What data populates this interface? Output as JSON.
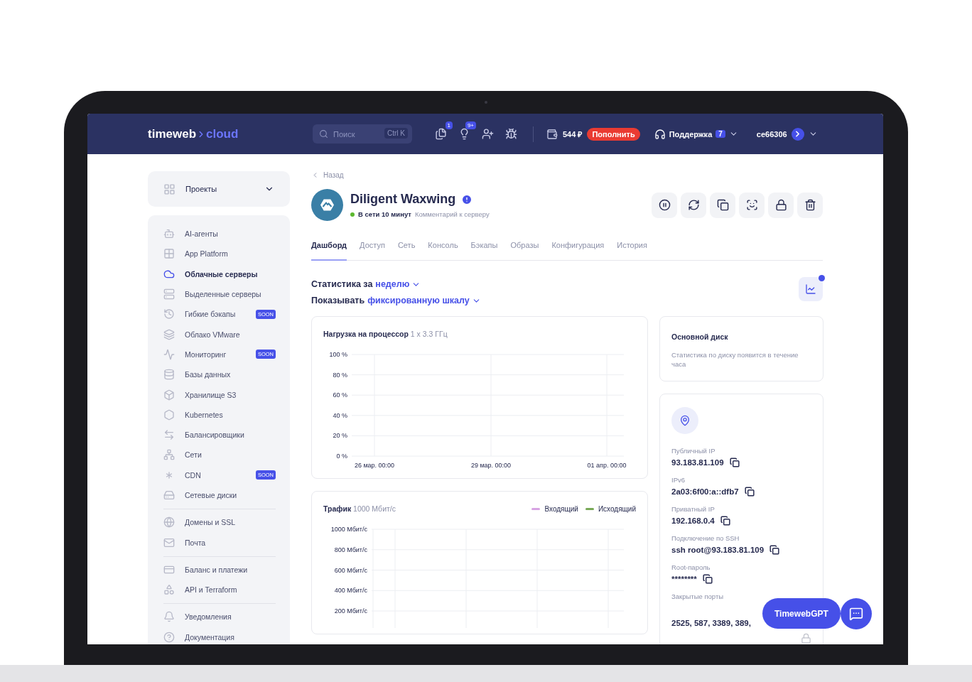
{
  "header": {
    "logo": {
      "left": "timeweb",
      "right": "cloud"
    },
    "search": {
      "placeholder": "Поиск",
      "shortcut": "Ctrl K"
    },
    "icon_badges": [
      "1",
      "9+"
    ],
    "balance": "544 ₽",
    "topup_button": "Пополнить",
    "support": {
      "label": "Поддержка",
      "badge": "7"
    },
    "account": "ce66306"
  },
  "sidebar": {
    "projects": "Проекты",
    "groups": [
      [
        {
          "label": "AI-агенты",
          "selected": false
        },
        {
          "label": "App Platform",
          "selected": false
        },
        {
          "label": "Облачные серверы",
          "selected": true
        },
        {
          "label": "Выделенные серверы",
          "selected": false
        },
        {
          "label": "Гибкие бэкапы",
          "badge": "SOON",
          "selected": false
        },
        {
          "label": "Облако VMware",
          "selected": false
        },
        {
          "label": "Мониторинг",
          "badge": "SOON",
          "selected": false
        },
        {
          "label": "Базы данных",
          "selected": false
        },
        {
          "label": "Хранилище S3",
          "selected": false
        },
        {
          "label": "Kubernetes",
          "selected": false
        },
        {
          "label": "Балансировщики",
          "selected": false
        },
        {
          "label": "Сети",
          "selected": false
        },
        {
          "label": "CDN",
          "badge": "SOON",
          "selected": false
        },
        {
          "label": "Сетевые диски",
          "selected": false
        }
      ],
      [
        {
          "label": "Домены и SSL",
          "selected": false
        },
        {
          "label": "Почта",
          "selected": false
        }
      ],
      [
        {
          "label": "Баланс и платежи",
          "selected": false
        },
        {
          "label": "API и Terraform",
          "selected": false
        }
      ],
      [
        {
          "label": "Уведомления",
          "selected": false
        },
        {
          "label": "Документация",
          "selected": false
        }
      ]
    ]
  },
  "server": {
    "back": "Назад",
    "name": "Diligent Waxwing",
    "online": true,
    "status": "В сети 10 минут",
    "comment": "Комментарий к серверу"
  },
  "tabs": [
    {
      "label": "Дашборд",
      "selected": true
    },
    {
      "label": "Доступ",
      "selected": false
    },
    {
      "label": "Сеть",
      "selected": false
    },
    {
      "label": "Консоль",
      "selected": false
    },
    {
      "label": "Бэкапы",
      "selected": false
    },
    {
      "label": "Образы",
      "selected": false
    },
    {
      "label": "Конфигурация",
      "selected": false
    },
    {
      "label": "История",
      "selected": false
    }
  ],
  "stats": {
    "period_prefix": "Статистика за",
    "period": "неделю",
    "scale_prefix": "Показывать",
    "scale": "фиксированную шкалу",
    "chart_notice": true
  },
  "cpu": {
    "title": "Нагрузка на процессор",
    "subtitle": "1 x 3.3 ГГц",
    "chart_data": {
      "type": "line",
      "grid": true,
      "categories": [
        "26 мар. 00:00",
        "29 мар. 00:00",
        "01 апр. 00:00"
      ],
      "ylim": [
        0,
        100
      ],
      "yticks": [
        {
          "value": 100,
          "label": "100 %"
        },
        {
          "value": 80,
          "label": "80 %"
        },
        {
          "value": 60,
          "label": "60 %"
        },
        {
          "value": 40,
          "label": "40 %"
        },
        {
          "value": 20,
          "label": "20 %"
        },
        {
          "value": 0,
          "label": "0 %"
        }
      ]
    }
  },
  "traffic": {
    "title": "Трафик",
    "subtitle": "1000 Мбит/с",
    "chart_data": {
      "type": "line",
      "grid": true,
      "ylim": [
        200,
        1000
      ],
      "yticks": [
        {
          "value": 1000,
          "label": "1000 Мбит/с"
        },
        {
          "value": 800,
          "label": "800 Мбит/с"
        },
        {
          "value": 600,
          "label": "600 Мбит/с"
        },
        {
          "value": 400,
          "label": "400 Мбит/с"
        },
        {
          "value": 200,
          "label": "200 Мбит/с"
        }
      ],
      "series": [
        {
          "name": "Входящий",
          "color": "#d7a3e3",
          "values": [
            null,
            null,
            null
          ]
        },
        {
          "name": "Исходящий",
          "color": "#78a957",
          "values": [
            null,
            null,
            null
          ]
        }
      ]
    }
  },
  "disk": {
    "title": "Основной диск",
    "text": "Статистика по диску появится в течение часа"
  },
  "network": [
    {
      "label": "Публичный IP",
      "value": "93.183.81.109",
      "copyable": true
    },
    {
      "label": "IPv6",
      "value": "2a03:6f00:a::dfb7",
      "copyable": true
    },
    {
      "label": "Приватный IP",
      "value": "192.168.0.4",
      "copyable": true
    },
    {
      "label": "Подключение по SSH",
      "value": "ssh root@93.183.81.109",
      "copyable": true
    },
    {
      "label": "Root-пароль",
      "value": "********",
      "copyable": true
    },
    {
      "label": "Закрытые порты",
      "value": "2525, 587, 3389, 389,",
      "copyable": false
    }
  ],
  "gpt_button": "TimewebGPT"
}
